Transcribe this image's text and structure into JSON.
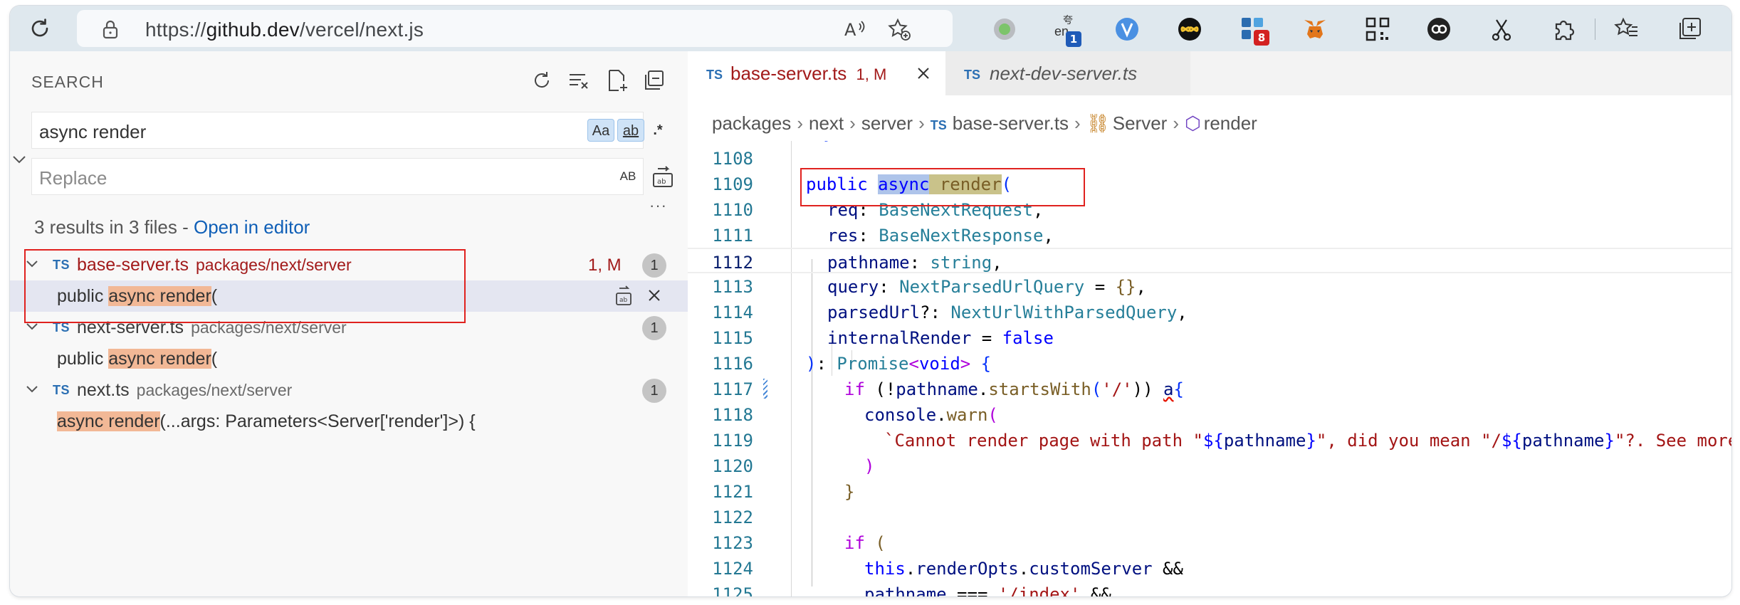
{
  "browser": {
    "url_prefix": "https://",
    "url_host": "github.dev",
    "url_path": "/vercel/next.js",
    "badges": {
      "translate": "1",
      "ext_grid": "8"
    },
    "translate_label": "en",
    "translate_sup": "夸"
  },
  "search": {
    "title": "SEARCH",
    "query": "async render",
    "replace_placeholder": "Replace",
    "options": {
      "match_case": "Aa",
      "whole_word": "ab",
      "regex": ".*",
      "preserve_case": "AB"
    },
    "more": "···",
    "summary": "3 results in 3 files - ",
    "open_in_editor": "Open in editor",
    "files": [
      {
        "lang": "TS",
        "name": "base-server.ts",
        "path": "packages/next/server",
        "status": "1, M",
        "count": "1",
        "match_pre": "public ",
        "match_hl": "async render",
        "match_post": "("
      },
      {
        "lang": "TS",
        "name": "next-server.ts",
        "path": "packages/next/server",
        "count": "1",
        "match_pre": "public ",
        "match_hl": "async render",
        "match_post": "("
      },
      {
        "lang": "TS",
        "name": "next.ts",
        "path": "packages/next/server",
        "count": "1",
        "match_pre": "",
        "match_hl": "async render",
        "match_post": "(...args: Parameters<Server['render']>) {"
      }
    ]
  },
  "editor": {
    "tabs": [
      {
        "lang": "TS",
        "name": "base-server.ts",
        "status": "1, M",
        "active": true
      },
      {
        "lang": "TS",
        "name": "next-dev-server.ts",
        "active": false
      }
    ],
    "breadcrumb": [
      "packages",
      "next",
      "server",
      "base-server.ts",
      "Server",
      "render"
    ],
    "breadcrumb_ts": "TS",
    "line_numbers": [
      "1108",
      "1109",
      "1110",
      "1111",
      "1112",
      "1113",
      "1114",
      "1115",
      "1116",
      "1117",
      "1118",
      "1119",
      "1120",
      "1121",
      "1122",
      "1123",
      "1124",
      "1125"
    ],
    "current_line": "1112",
    "code": {
      "l1109_a": "public ",
      "l1109_b": "async",
      "l1109_c": " render",
      "l1109_d": "(",
      "l1110_a": "req",
      "l1110_b": ": ",
      "l1110_c": "BaseNextRequest",
      "l1110_d": ",",
      "l1111_a": "res",
      "l1111_b": ": ",
      "l1111_c": "BaseNextResponse",
      "l1111_d": ",",
      "l1112_a": "pathname",
      "l1112_b": ": ",
      "l1112_c": "string",
      "l1112_d": ",",
      "l1113_a": "query",
      "l1113_b": ": ",
      "l1113_c": "NextParsedUrlQuery",
      "l1113_d": " = ",
      "l1113_e": "{}",
      "l1113_f": ",",
      "l1114_a": "parsedUrl",
      "l1114_b": "?: ",
      "l1114_c": "NextUrlWithParsedQuery",
      "l1114_d": ",",
      "l1115_a": "internalRender",
      "l1115_b": " = ",
      "l1115_c": "false",
      "l1116_a": ")",
      "l1116_b": ": ",
      "l1116_c": "Promise",
      "l1116_d": "<",
      "l1116_e": "void",
      "l1116_f": "> ",
      "l1116_g": "{",
      "l1117_a": "if",
      "l1117_b": " (!",
      "l1117_c": "pathname",
      "l1117_d": ".",
      "l1117_e": "startsWith",
      "l1117_f": "(",
      "l1117_g": "'/'",
      "l1117_h": ")) ",
      "l1117_i": "a",
      "l1117_j": "{",
      "l1118_a": "console",
      "l1118_b": ".",
      "l1118_c": "warn",
      "l1118_d": "(",
      "l1119_a": "`Cannot render page with path \"",
      "l1119_b": "${",
      "l1119_c": "pathname",
      "l1119_d": "}",
      "l1119_e": "\", did you mean \"/",
      "l1119_f": "${",
      "l1119_g": "pathname",
      "l1119_h": "}",
      "l1119_i": "\"?. See more",
      "l1120_a": ")",
      "l1121_a": "}",
      "l1123_a": "if",
      "l1123_b": " (",
      "l1124_a": "this",
      "l1124_b": ".",
      "l1124_c": "renderOpts",
      "l1124_d": ".",
      "l1124_e": "customServer",
      "l1124_f": " &&",
      "l1125_a": "pathname",
      "l1125_b": " === ",
      "l1125_c": "'/index'",
      "l1125_d": " &&"
    }
  },
  "colors": {
    "accent": "#0f5fb7",
    "modified": "#a21a1a",
    "match_highlight": "#f2b896",
    "annotation_box": "#e0221f"
  }
}
